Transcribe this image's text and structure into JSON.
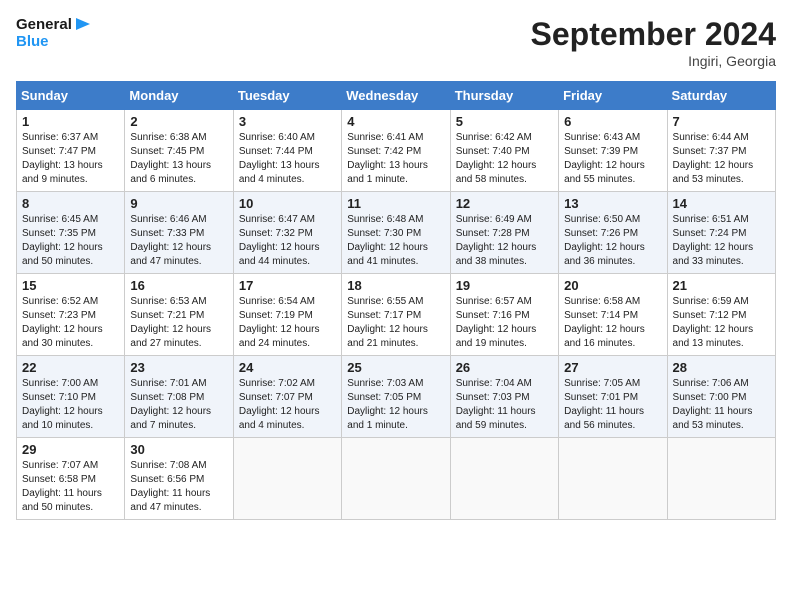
{
  "header": {
    "logo_line1": "General",
    "logo_line2": "Blue",
    "month_year": "September 2024",
    "location": "Ingiri, Georgia"
  },
  "weekdays": [
    "Sunday",
    "Monday",
    "Tuesday",
    "Wednesday",
    "Thursday",
    "Friday",
    "Saturday"
  ],
  "weeks": [
    [
      {
        "day": "1",
        "sunrise": "6:37 AM",
        "sunset": "7:47 PM",
        "daylight": "13 hours and 9 minutes."
      },
      {
        "day": "2",
        "sunrise": "6:38 AM",
        "sunset": "7:45 PM",
        "daylight": "13 hours and 6 minutes."
      },
      {
        "day": "3",
        "sunrise": "6:40 AM",
        "sunset": "7:44 PM",
        "daylight": "13 hours and 4 minutes."
      },
      {
        "day": "4",
        "sunrise": "6:41 AM",
        "sunset": "7:42 PM",
        "daylight": "13 hours and 1 minute."
      },
      {
        "day": "5",
        "sunrise": "6:42 AM",
        "sunset": "7:40 PM",
        "daylight": "12 hours and 58 minutes."
      },
      {
        "day": "6",
        "sunrise": "6:43 AM",
        "sunset": "7:39 PM",
        "daylight": "12 hours and 55 minutes."
      },
      {
        "day": "7",
        "sunrise": "6:44 AM",
        "sunset": "7:37 PM",
        "daylight": "12 hours and 53 minutes."
      }
    ],
    [
      {
        "day": "8",
        "sunrise": "6:45 AM",
        "sunset": "7:35 PM",
        "daylight": "12 hours and 50 minutes."
      },
      {
        "day": "9",
        "sunrise": "6:46 AM",
        "sunset": "7:33 PM",
        "daylight": "12 hours and 47 minutes."
      },
      {
        "day": "10",
        "sunrise": "6:47 AM",
        "sunset": "7:32 PM",
        "daylight": "12 hours and 44 minutes."
      },
      {
        "day": "11",
        "sunrise": "6:48 AM",
        "sunset": "7:30 PM",
        "daylight": "12 hours and 41 minutes."
      },
      {
        "day": "12",
        "sunrise": "6:49 AM",
        "sunset": "7:28 PM",
        "daylight": "12 hours and 38 minutes."
      },
      {
        "day": "13",
        "sunrise": "6:50 AM",
        "sunset": "7:26 PM",
        "daylight": "12 hours and 36 minutes."
      },
      {
        "day": "14",
        "sunrise": "6:51 AM",
        "sunset": "7:24 PM",
        "daylight": "12 hours and 33 minutes."
      }
    ],
    [
      {
        "day": "15",
        "sunrise": "6:52 AM",
        "sunset": "7:23 PM",
        "daylight": "12 hours and 30 minutes."
      },
      {
        "day": "16",
        "sunrise": "6:53 AM",
        "sunset": "7:21 PM",
        "daylight": "12 hours and 27 minutes."
      },
      {
        "day": "17",
        "sunrise": "6:54 AM",
        "sunset": "7:19 PM",
        "daylight": "12 hours and 24 minutes."
      },
      {
        "day": "18",
        "sunrise": "6:55 AM",
        "sunset": "7:17 PM",
        "daylight": "12 hours and 21 minutes."
      },
      {
        "day": "19",
        "sunrise": "6:57 AM",
        "sunset": "7:16 PM",
        "daylight": "12 hours and 19 minutes."
      },
      {
        "day": "20",
        "sunrise": "6:58 AM",
        "sunset": "7:14 PM",
        "daylight": "12 hours and 16 minutes."
      },
      {
        "day": "21",
        "sunrise": "6:59 AM",
        "sunset": "7:12 PM",
        "daylight": "12 hours and 13 minutes."
      }
    ],
    [
      {
        "day": "22",
        "sunrise": "7:00 AM",
        "sunset": "7:10 PM",
        "daylight": "12 hours and 10 minutes."
      },
      {
        "day": "23",
        "sunrise": "7:01 AM",
        "sunset": "7:08 PM",
        "daylight": "12 hours and 7 minutes."
      },
      {
        "day": "24",
        "sunrise": "7:02 AM",
        "sunset": "7:07 PM",
        "daylight": "12 hours and 4 minutes."
      },
      {
        "day": "25",
        "sunrise": "7:03 AM",
        "sunset": "7:05 PM",
        "daylight": "12 hours and 1 minute."
      },
      {
        "day": "26",
        "sunrise": "7:04 AM",
        "sunset": "7:03 PM",
        "daylight": "11 hours and 59 minutes."
      },
      {
        "day": "27",
        "sunrise": "7:05 AM",
        "sunset": "7:01 PM",
        "daylight": "11 hours and 56 minutes."
      },
      {
        "day": "28",
        "sunrise": "7:06 AM",
        "sunset": "7:00 PM",
        "daylight": "11 hours and 53 minutes."
      }
    ],
    [
      {
        "day": "29",
        "sunrise": "7:07 AM",
        "sunset": "6:58 PM",
        "daylight": "11 hours and 50 minutes."
      },
      {
        "day": "30",
        "sunrise": "7:08 AM",
        "sunset": "6:56 PM",
        "daylight": "11 hours and 47 minutes."
      },
      null,
      null,
      null,
      null,
      null
    ]
  ]
}
